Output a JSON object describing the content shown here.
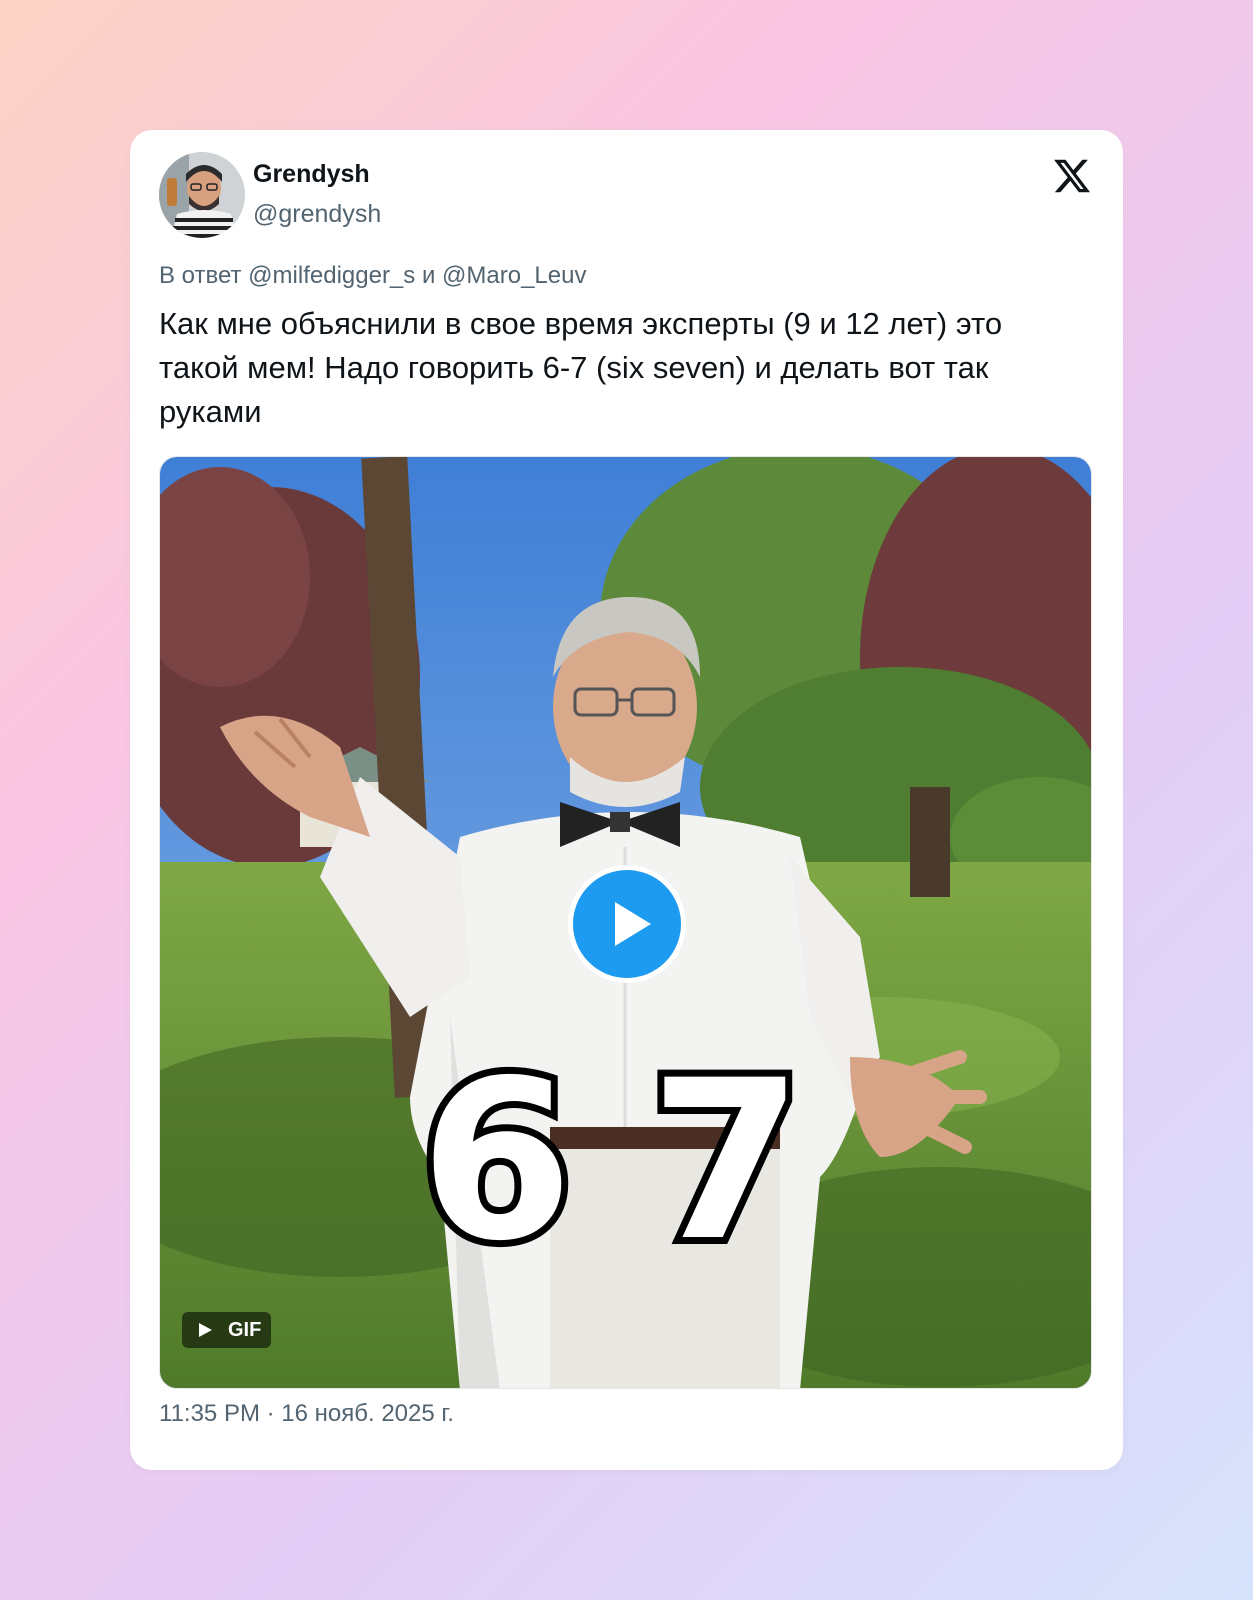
{
  "author": {
    "display_name": "Grendysh",
    "handle": "@grendysh"
  },
  "reply": {
    "text": "В ответ @milfedigger_s и @Maro_Leuv"
  },
  "tweet": {
    "text": "Как мне объяснили в свое время эксперты (9 и 12 лет) это такой мем! Надо говорить 6-7 (six seven) и делать вот так руками"
  },
  "media": {
    "type_label": "GIF",
    "overlay_text": "6 7"
  },
  "meta": {
    "timestamp": "11:35 PM · 16 нояб. 2025 г."
  },
  "colors": {
    "accent": "#1d9bf0",
    "text_primary": "#0f1419",
    "text_secondary": "#536471"
  },
  "icons": {
    "brand": "x-logo-icon",
    "play": "play-icon"
  }
}
